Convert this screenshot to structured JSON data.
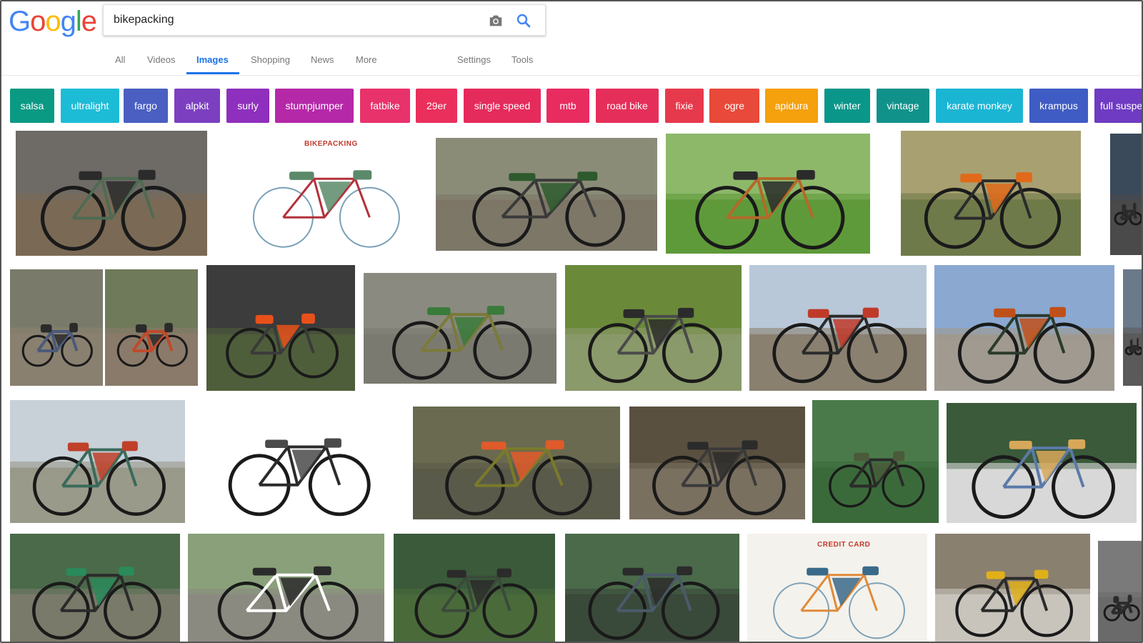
{
  "logo": {
    "letters": [
      "G",
      "o",
      "o",
      "g",
      "l",
      "e"
    ],
    "colors": [
      "#4285F4",
      "#EA4335",
      "#FBBC05",
      "#4285F4",
      "#34A853",
      "#EA4335"
    ]
  },
  "search": {
    "query": "bikepacking",
    "camera_icon": "camera-icon",
    "search_icon": "search-icon",
    "accent": "#4285F4"
  },
  "tabs": [
    {
      "label": "All"
    },
    {
      "label": "Videos"
    },
    {
      "label": "Images",
      "active": true
    },
    {
      "label": "Shopping"
    },
    {
      "label": "News"
    },
    {
      "label": "More"
    },
    {
      "label": "Settings"
    },
    {
      "label": "Tools"
    }
  ],
  "chips": [
    {
      "label": "salsa",
      "color": "#0a9a84"
    },
    {
      "label": "ultralight",
      "color": "#1dbcd6"
    },
    {
      "label": "fargo",
      "color": "#4a5fc1"
    },
    {
      "label": "alpkit",
      "color": "#7b3fbf"
    },
    {
      "label": "surly",
      "color": "#8e2fbd"
    },
    {
      "label": "stumpjumper",
      "color": "#b528a8"
    },
    {
      "label": "fatbike",
      "color": "#e8326c"
    },
    {
      "label": "29er",
      "color": "#ea2f5c"
    },
    {
      "label": "single speed",
      "color": "#e52b5c"
    },
    {
      "label": "mtb",
      "color": "#e82c60"
    },
    {
      "label": "road bike",
      "color": "#e52f5a"
    },
    {
      "label": "fixie",
      "color": "#e63a4c"
    },
    {
      "label": "ogre",
      "color": "#e8493a"
    },
    {
      "label": "apidura",
      "color": "#f5a00d"
    },
    {
      "label": "winter",
      "color": "#0b968a"
    },
    {
      "label": "vintage",
      "color": "#10928a"
    },
    {
      "label": "karate monkey",
      "color": "#1bb5d4"
    },
    {
      "label": "krampus",
      "color": "#3f5cc4"
    },
    {
      "label": "full suspens",
      "color": "#6e3bc2"
    }
  ],
  "thumbnails": {
    "sketch_1_title": "BIKEPACKING",
    "sketch_2_title": "CREDIT CARD"
  }
}
